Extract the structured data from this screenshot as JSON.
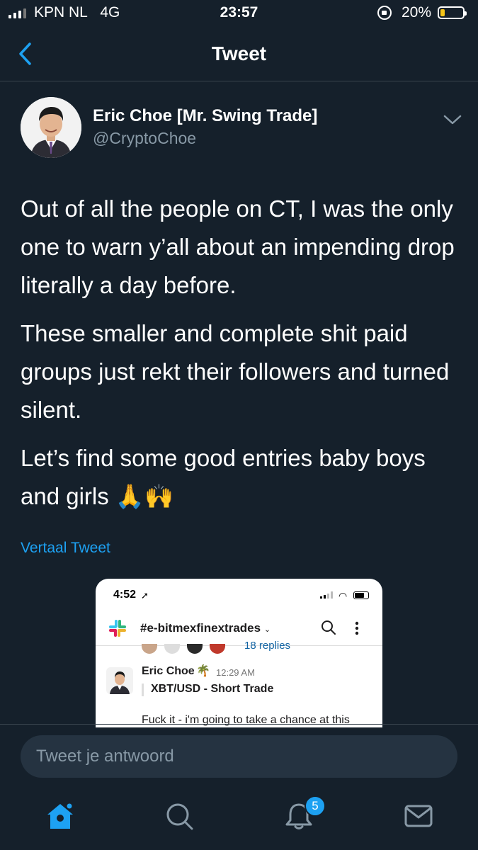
{
  "status_bar": {
    "carrier": "KPN NL",
    "network": "4G",
    "time": "23:57",
    "battery_percent": "20%",
    "battery_level": 0.2
  },
  "nav": {
    "title": "Tweet"
  },
  "tweet": {
    "author_name": "Eric Choe [Mr. Swing Trade]",
    "author_handle": "@CryptoChoe",
    "paragraphs": [
      "Out of all the people on CT, I was the only one to warn y’all about an impending drop literally a day before.",
      "These smaller and complete shit paid groups just rekt their followers and turned silent.",
      "Let’s find some good entries baby boys and girls 🙏🙌"
    ],
    "translate_link": "Vertaal Tweet"
  },
  "embedded_image": {
    "time": "4:52",
    "channel": "#e-bitmexfinextrades",
    "replies": "18 replies",
    "user": "Eric Choe",
    "message_time": "12:29 AM",
    "trade_title": "XBT/USD - Short Trade",
    "message": "Fuck it - i'm going to take a chance at this"
  },
  "reply": {
    "placeholder": "Tweet je antwoord"
  },
  "tab_bar": {
    "icons": [
      "home-icon",
      "search-icon",
      "notifications-icon",
      "messages-icon"
    ],
    "notification_badge": "5"
  },
  "colors": {
    "background": "#15202b",
    "accent": "#1da1f2",
    "muted": "#8899a6"
  }
}
